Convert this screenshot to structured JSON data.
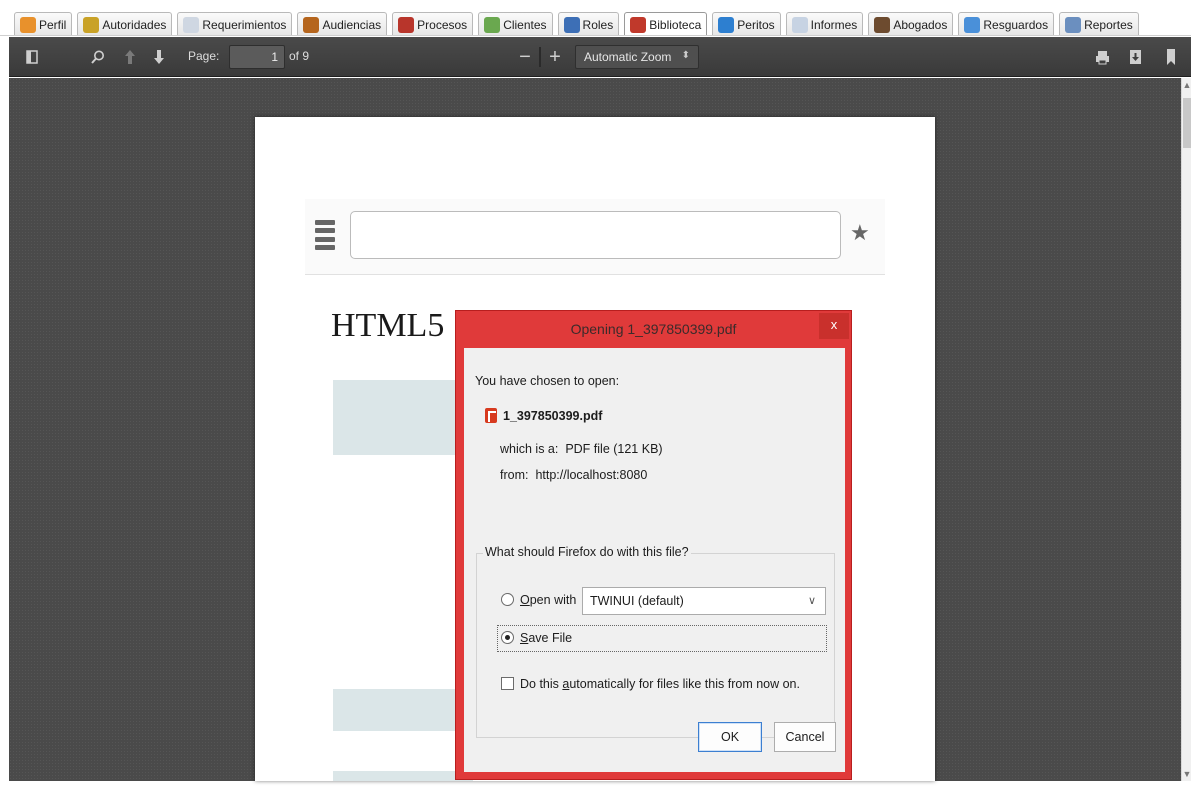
{
  "tabs": [
    {
      "label": "Perfil",
      "icon": "profile-icon",
      "color": "#e8912c"
    },
    {
      "label": "Autoridades",
      "icon": "authorities-icon",
      "color": "#c9a227"
    },
    {
      "label": "Requerimientos",
      "icon": "requirements-icon",
      "color": "#cfd7e2"
    },
    {
      "label": "Audiencias",
      "icon": "hearings-icon",
      "color": "#b5651d"
    },
    {
      "label": "Procesos",
      "icon": "processes-icon",
      "color": "#b8352b"
    },
    {
      "label": "Clientes",
      "icon": "clients-icon",
      "color": "#6aa84f"
    },
    {
      "label": "Roles",
      "icon": "roles-icon",
      "color": "#3d6fb6"
    },
    {
      "label": "Biblioteca",
      "icon": "library-icon",
      "color": "#c0392b"
    },
    {
      "label": "Peritos",
      "icon": "experts-icon",
      "color": "#2d7fd0"
    },
    {
      "label": "Informes",
      "icon": "reports-icon",
      "color": "#c7d3e3"
    },
    {
      "label": "Abogados",
      "icon": "lawyers-icon",
      "color": "#6d4b2f"
    },
    {
      "label": "Resguardos",
      "icon": "safeguards-icon",
      "color": "#4a90d9"
    },
    {
      "label": "Reportes",
      "icon": "report-pages-icon",
      "color": "#6b8fbf"
    }
  ],
  "active_tab": "Biblioteca",
  "toolbar": {
    "page_label": "Page:",
    "page_value": "1",
    "page_of": "of 9",
    "zoom_value": "Automatic Zoom",
    "zoom_minus": "−",
    "zoom_plus": "+"
  },
  "pdf": {
    "heading": "HTML5"
  },
  "dialog": {
    "title": "Opening 1_397850399.pdf",
    "close_label": "x",
    "intro": "You have chosen to open:",
    "filename": "1_397850399.pdf",
    "type_label": "which is a:",
    "type_value": "PDF file (121 KB)",
    "from_label": "from:",
    "from_value": "http://localhost:8080",
    "question": "What should Firefox do with this file?",
    "open_with_label": "Open with",
    "open_with_value": "TWINUI (default)",
    "save_file_label": "Save File",
    "auto_label": "Do this automatically for files like this from now on.",
    "ok_label": "OK",
    "cancel_label": "Cancel",
    "selected_option": "Save File"
  },
  "colors": {
    "toolbar": "#3f3f3f",
    "viewer": "#4a4a4a",
    "dialog_border": "#e03a3a",
    "dialog_title": "#3b2b2b"
  }
}
